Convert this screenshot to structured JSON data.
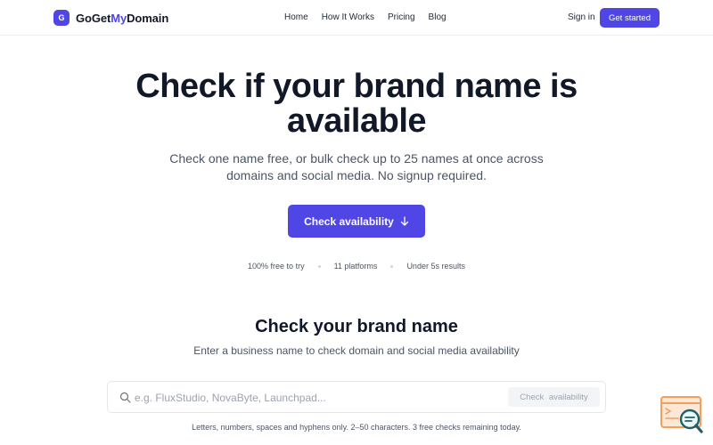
{
  "brand": {
    "badge": "G",
    "name_part1": "GoGet",
    "name_accent": "My",
    "name_part2": "Domain",
    "accent_color": "#4f46e5"
  },
  "nav": {
    "items": [
      {
        "label": "Home"
      },
      {
        "label": "How It Works"
      },
      {
        "label": "Pricing"
      },
      {
        "label": "Blog"
      }
    ],
    "signin_label": "Sign in",
    "cta_label": "Get started"
  },
  "hero": {
    "title": "Check if your brand name is available",
    "subtitle": "Check one name free, or bulk check up to 25 names at once across domains and social media. No signup required.",
    "button_label": "Check availability",
    "button_icon": "arrow-down-icon",
    "features": [
      "100% free to try",
      "11 platforms",
      "Under 5s results"
    ]
  },
  "checker": {
    "title": "Check your brand name",
    "subtitle": "Enter a business name to check domain and social media availability",
    "input_placeholder": "e.g. FluxStudio, NovaByte, Launchpad...",
    "input_value": "",
    "button_label": "Check availability",
    "helper": "Letters, numbers, spaces and hyphens only. 2–50 characters. 3 free checks remaining today."
  },
  "widget": {
    "icon": "search-chat-widget-icon"
  }
}
